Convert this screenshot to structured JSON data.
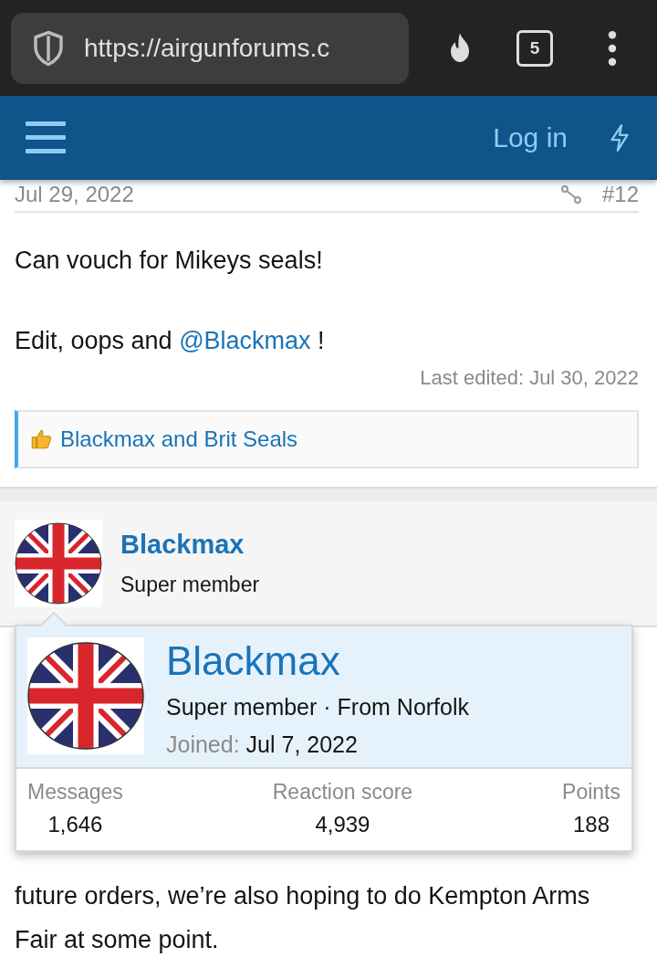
{
  "browser": {
    "url": "https://airgunforums.c",
    "tab_count": "5"
  },
  "nav": {
    "login": "Log in"
  },
  "post": {
    "date": "Jul 29, 2022",
    "number": "#12",
    "paragraphs": [
      "Can vouch for Mikeys seals!"
    ],
    "edit_line": {
      "text": "Edit, oops and ",
      "mention": "@Blackmax",
      "end": " !"
    },
    "last_edited": "Last edited: Jul 30, 2022",
    "reactions": "Blackmax and Brit Seals"
  },
  "next_post": {
    "author": "Blackmax",
    "title": "Super member",
    "body": "future orders, we’re also hoping to do Kempton Arms Fair at some point."
  },
  "member_card": {
    "name": "Blackmax",
    "subtitle": "Super member · From Norfolk",
    "joined_label": "Joined:",
    "joined": "Jul 7, 2022",
    "stats": [
      {
        "label": "Messages",
        "value": "1,646"
      },
      {
        "label": "Reaction score",
        "value": "4,939"
      },
      {
        "label": "Points",
        "value": "188"
      }
    ]
  }
}
